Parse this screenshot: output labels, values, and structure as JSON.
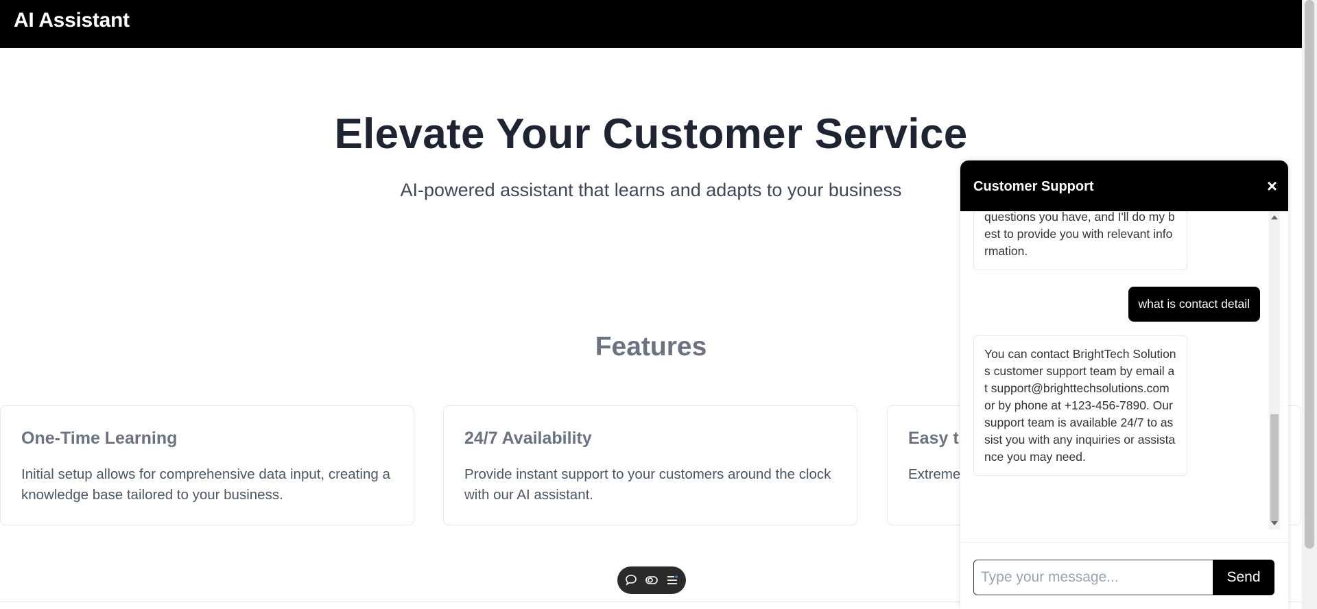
{
  "header": {
    "brand": "AI Assistant"
  },
  "hero": {
    "title": "Elevate Your Customer Service",
    "subtitle": "AI-powered assistant that learns and adapts to your business"
  },
  "features": {
    "title": "Features",
    "cards": [
      {
        "title": "One-Time Learning",
        "desc": "Initial setup allows for comprehensive data input, creating a knowledge base tailored to your business."
      },
      {
        "title": "24/7 Availability",
        "desc": "Provide instant support to your customers around the clock with our AI assistant."
      },
      {
        "title": "Easy t",
        "desc": "Extreme"
      }
    ]
  },
  "toolbar": {
    "icons": [
      "chat-bubble-icon",
      "toggle-icon",
      "list-icon"
    ]
  },
  "chat": {
    "title": "Customer Support",
    "close_label": "×",
    "messages": [
      {
        "from": "bot",
        "text": "questions you have, and I'll do my best to provide you with relevant information."
      },
      {
        "from": "user",
        "text": "what is contact detail"
      },
      {
        "from": "bot",
        "text": "You can contact BrightTech Solutions customer support team by email at support@brighttechsolutions.com or by phone at +123-456-7890. Our support team is available 24/7 to assist you with any inquiries or assistance you may need."
      }
    ],
    "input_placeholder": "Type your message...",
    "send_label": "Send"
  }
}
